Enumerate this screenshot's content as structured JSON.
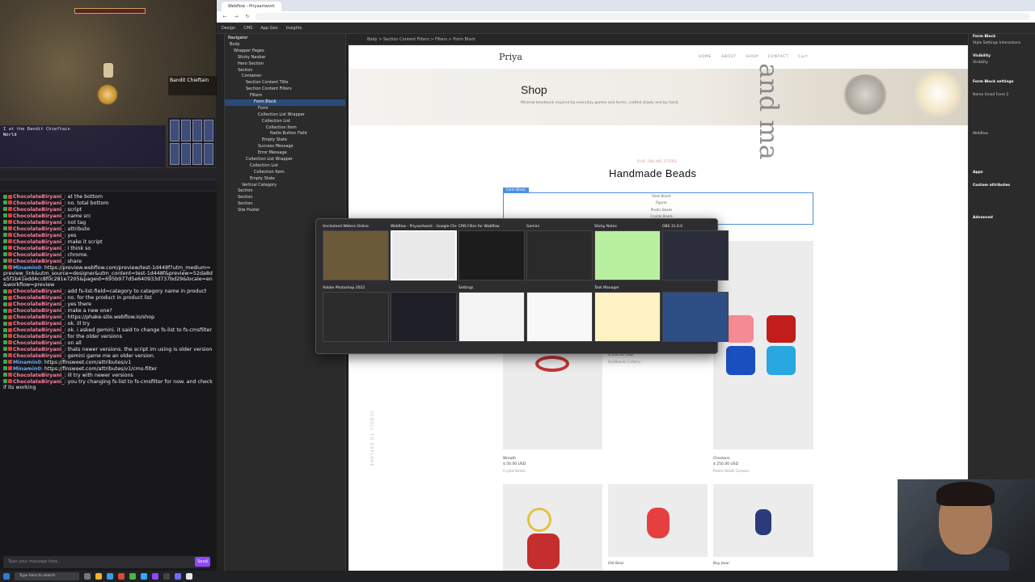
{
  "game": {
    "enemy_name": "Bandit Chieftain",
    "chat_tab": "World",
    "chat_lines": [
      "I at the Bandit Chieftain",
      "",
      "",
      "",
      ""
    ]
  },
  "chat": {
    "browser_tab": "",
    "url": "",
    "input_placeholder": "Type your message here...",
    "send_label": "Send",
    "footer_user": "",
    "messages": [
      {
        "user": "ChocolateBiryani_",
        "text": "at the bottom"
      },
      {
        "user": "ChocolateBiryani_",
        "text": "no. total bottom"
      },
      {
        "user": "ChocolateBiryani_",
        "text": "script"
      },
      {
        "user": "ChocolateBiryani_",
        "text": "name src"
      },
      {
        "user": "ChocolateBiryani_",
        "text": "not tag"
      },
      {
        "user": "ChocolateBiryani_",
        "text": "attribute"
      },
      {
        "user": "ChocolateBiryani_",
        "text": "yes"
      },
      {
        "user": "ChocolateBiryani_",
        "text": "make it script"
      },
      {
        "user": "ChocolateBiryani_",
        "text": "i think so"
      },
      {
        "user": "ChocolateBiryani_",
        "text": "chrome."
      },
      {
        "user": "ChocolateBiryani_",
        "text": "share"
      },
      {
        "user": "Minamin0",
        "alt": true,
        "text": "https://preview.webflow.com/preview/test-1d448f?utm_medium=preview_link&utm_source=designer&utm_content=test-1d448f&preview=52da8de5f1b41edd4cc8f0c281e7205&pageid=695b977d5e640933d737bd29&locale=en&workflow=preview"
      },
      {
        "user": "ChocolateBiryani_",
        "text": "add fs-list-field=category to category name in product"
      },
      {
        "user": "ChocolateBiryani_",
        "text": "no. for the product in product list"
      },
      {
        "user": "ChocolateBiryani_",
        "text": "yes there"
      },
      {
        "user": "ChocolateBiryani_",
        "text": "make a new one?"
      },
      {
        "user": "ChocolateBiryani_",
        "text": "https://phake-site.webflow.io/shop"
      },
      {
        "user": "ChocolateBiryani_",
        "text": "ok. ill try"
      },
      {
        "user": "ChocolateBiryani_",
        "text": "ok. i asked gemini. it said to change fs-list to fs-cmsfilter"
      },
      {
        "user": "ChocolateBiryani_",
        "text": "for the older versions"
      },
      {
        "user": "ChocolateBiryani_",
        "text": "on all"
      },
      {
        "user": "ChocolateBiryani_",
        "text": "thats newer versions. the script im using is older version"
      },
      {
        "user": "ChocolateBiryani_",
        "text": "gemini game me an older version."
      },
      {
        "user": "Minamin0",
        "alt": true,
        "text": "https://finsweet.com/attributes/v1"
      },
      {
        "user": "Minamin0",
        "alt": true,
        "text": "https://finsweet.com/attributes/v1/cms-filter"
      },
      {
        "user": "ChocolateBiryani_",
        "text": "ill try with newer versions"
      },
      {
        "user": "ChocolateBiryani_",
        "text": "you try changing fs-list to fs-cmsfilter for now. and check if its working"
      }
    ]
  },
  "browser": {
    "tab_title": "Webflow - Priyaartwork",
    "url": ""
  },
  "webflow": {
    "top_items": [
      "Design",
      "CMS",
      "App Gen",
      "Insights"
    ],
    "breadcrumb": "Body  >  Section Content Filters  >  Filters  >  Form Block",
    "navigator_title": "Navigator",
    "navigator": [
      {
        "label": "Body",
        "indent": 0
      },
      {
        "label": "Wrapper Pages",
        "indent": 1
      },
      {
        "label": "Sticky Navbar",
        "indent": 2
      },
      {
        "label": "Hero Section",
        "indent": 2
      },
      {
        "label": "Section",
        "indent": 2
      },
      {
        "label": "Container",
        "indent": 3
      },
      {
        "label": "Section Content Title",
        "indent": 4
      },
      {
        "label": "Section Content Filters",
        "indent": 4
      },
      {
        "label": "Filters",
        "indent": 5
      },
      {
        "label": "Form Block",
        "indent": 6,
        "selected": true
      },
      {
        "label": "Form",
        "indent": 7
      },
      {
        "label": "Collection List Wrapper",
        "indent": 7
      },
      {
        "label": "Collection List",
        "indent": 8
      },
      {
        "label": "Collection Item",
        "indent": 9
      },
      {
        "label": "Radio Button Field",
        "indent": 10
      },
      {
        "label": "Empty State",
        "indent": 8
      },
      {
        "label": "Success Message",
        "indent": 7
      },
      {
        "label": "Error Message",
        "indent": 7
      },
      {
        "label": "Collection List Wrapper",
        "indent": 4
      },
      {
        "label": "Collection List",
        "indent": 5
      },
      {
        "label": "Collection Item",
        "indent": 6
      },
      {
        "label": "Empty State",
        "indent": 5
      },
      {
        "label": "Vertical Category",
        "indent": 3
      },
      {
        "label": "Section",
        "indent": 2
      },
      {
        "label": "Section",
        "indent": 2
      },
      {
        "label": "Section",
        "indent": 2
      },
      {
        "label": "Site Footer",
        "indent": 2
      }
    ],
    "right_panel": [
      {
        "label": "Form Block",
        "head": true
      },
      {
        "label": "Style   Settings   Interactions",
        "head": false
      },
      {
        "label": "",
        "head": false
      },
      {
        "label": "Visibility",
        "head": true
      },
      {
        "label": "Visibility",
        "head": false
      },
      {
        "label": "",
        "head": false
      },
      {
        "label": "",
        "head": false
      },
      {
        "label": "Form Block settings",
        "head": true
      },
      {
        "label": "",
        "head": false
      },
      {
        "label": "Name   Email Form 2",
        "head": false
      },
      {
        "label": "",
        "head": false
      },
      {
        "label": "",
        "head": false
      },
      {
        "label": "",
        "head": false
      },
      {
        "label": "",
        "head": false
      },
      {
        "label": "",
        "head": false
      },
      {
        "label": "Webflow",
        "head": false
      },
      {
        "label": "",
        "head": false
      },
      {
        "label": "",
        "head": false
      },
      {
        "label": "",
        "head": false
      },
      {
        "label": "",
        "head": false
      },
      {
        "label": "",
        "head": false
      },
      {
        "label": "Apps",
        "head": true
      },
      {
        "label": "",
        "head": false
      },
      {
        "label": "Custom attributes",
        "head": true
      },
      {
        "label": "",
        "head": false
      },
      {
        "label": "",
        "head": false
      },
      {
        "label": "",
        "head": false
      },
      {
        "label": "",
        "head": false
      },
      {
        "label": "Advanced",
        "head": true
      },
      {
        "label": "",
        "head": false
      },
      {
        "label": "",
        "head": false
      },
      {
        "label": "",
        "head": false
      },
      {
        "label": "",
        "head": false
      },
      {
        "label": "",
        "head": false
      }
    ]
  },
  "site": {
    "logo": "Priya",
    "nav": [
      "HOME",
      "ABOUT",
      "SHOP",
      "CONTACT",
      "Cart"
    ],
    "hero_title": "Shop",
    "hero_subtitle": "Minimal beadwork inspired by everyday games and forms, crafted slowly and by hand.",
    "hero_deco": "and ma",
    "eyebrow": "OUR ONLINE STORE",
    "section_title": "Handmade Beads",
    "form_tag": "Form Block",
    "filters": [
      "Steel Beads",
      "Figures",
      "Plastic Beads",
      "Crystal Beads"
    ],
    "products": [
      {
        "name": "Wreath",
        "price": "$ 50.00 USD",
        "category": "Crystal Beads"
      },
      {
        "name": "",
        "price": "$ 200.00 USD",
        "category": "Seedbeads Curtains"
      },
      {
        "name": "Checkers",
        "price": "$ 250.00 USD",
        "category": "Plastic Beads Curtains"
      },
      {
        "name": "",
        "price": "",
        "category": ""
      },
      {
        "name": "Old Bear",
        "price": "",
        "category": ""
      },
      {
        "name": "Boy bear",
        "price": "",
        "category": ""
      }
    ],
    "side_text": "SCROLL TO EXPLORE"
  },
  "switcher": {
    "windows": [
      {
        "title": "Unclaimed Waters Online",
        "color": "#6b5a3a",
        "active": false
      },
      {
        "title": "Webflow - Priyaartwork - Google Chrome",
        "color": "#e9e9e9",
        "active": true
      },
      {
        "title": "CMS Filter for Webflow",
        "color": "#1c1c1c",
        "active": false
      },
      {
        "title": "Gemini",
        "color": "#2a2a2a",
        "active": false
      },
      {
        "title": "Sticky Notes",
        "color": "#b8f0a0",
        "active": false
      },
      {
        "title": "OBS 31.0.0",
        "color": "#2b2e3a",
        "active": false
      },
      {
        "title": "Adobe Photoshop 2022",
        "color": "#2c2c2c",
        "active": false
      },
      {
        "title": "",
        "color": "#1f1f28",
        "active": false
      },
      {
        "title": "Settings",
        "color": "#f3f3f3",
        "active": false
      },
      {
        "title": "",
        "color": "#f8f8f8",
        "active": false
      },
      {
        "title": "Task Manager",
        "color": "#fff3c4",
        "active": false
      },
      {
        "title": "",
        "color": "#2d4f86",
        "active": false
      }
    ]
  },
  "taskbar": {
    "search_placeholder": "Type here to search"
  },
  "colors": {
    "webflow_blue": "#4a90e2",
    "twitch_purple": "#9147ff",
    "chat_name": "#ff7fa0"
  }
}
